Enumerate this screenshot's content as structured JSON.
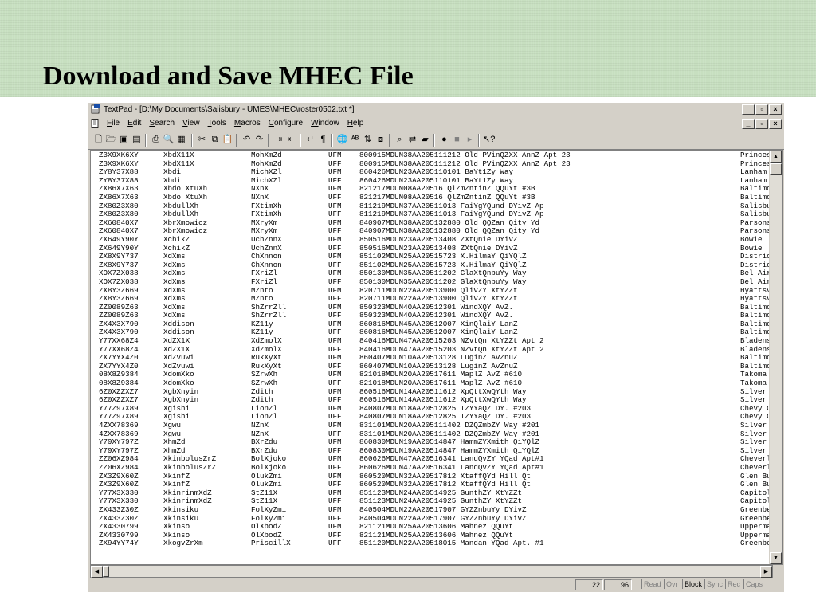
{
  "slide": {
    "title": "Download and Save MHEC File"
  },
  "window": {
    "title": "TextPad - [D:\\My Documents\\Salisbury - UMES\\MHEC\\roster0502.txt *]",
    "menus": [
      "File",
      "Edit",
      "Search",
      "View",
      "Tools",
      "Macros",
      "Configure",
      "Window",
      "Help"
    ]
  },
  "rows": [
    [
      "Z3X9XK6XY",
      "XbdX11X",
      "MohXmZd",
      "UFM",
      "800915MDUN38AA205111212 Old PVinQZXX AnnZ Apt 23",
      "Princess A"
    ],
    [
      "Z3X9XK6XY",
      "XbdX11X",
      "MohXmZd",
      "UFF",
      "800915MDUN38AA205111212 Old PVinQZXX AnnZ Apt 23",
      "Princess A"
    ],
    [
      "ZY8Y37X88",
      "Xbdi",
      "MichXZl",
      "UFM",
      "860426MDUN23AA205110101 BaYt1Zy Way",
      "Lanham"
    ],
    [
      "ZY8Y37X88",
      "Xbdi",
      "MichXZl",
      "UFF",
      "860426MDUN23AA205110101 BaYt1Zy Way",
      "Lanham"
    ],
    [
      "ZX86X7X63",
      "Xbdo XtuXh",
      "NXnX",
      "UFM",
      "821217MDUN08AA20516 QlZmZntinZ QQuYt #3B",
      "Baltimore"
    ],
    [
      "ZX86X7X63",
      "Xbdo XtuXh",
      "NXnX",
      "UFF",
      "821217MDUN08AA20516 QlZmZntinZ QQuYt #3B",
      "Baltimore"
    ],
    [
      "ZX80Z3X80",
      "XbdullXh",
      "FXtimXh",
      "UFM",
      "811219MDUN37AA20511013 FaiYgYQund DYivZ Ap",
      "Salisbury"
    ],
    [
      "ZX80Z3X80",
      "XbdullXh",
      "FXtimXh",
      "UFF",
      "811219MDUN37AA20511013 FaiYgYQund DYivZ Ap",
      "Salisbury"
    ],
    [
      "ZX60840X7",
      "XbrXmowicz",
      "MXryXm",
      "UFM",
      "840907MDUN38AA205132880 Old QQZan Qity Yd",
      "Parsonsbur"
    ],
    [
      "ZX60840X7",
      "XbrXmowicz",
      "MXryXm",
      "UFF",
      "840907MDUN38AA205132880 Old QQZan Qity Yd",
      "Parsonsbur"
    ],
    [
      "ZX649Y90Y",
      "XchikZ",
      "UchZnnX",
      "UFM",
      "850516MDUN23AA20513408 ZXtQnie DYivZ",
      "Bowie"
    ],
    [
      "ZX649Y90Y",
      "XchikZ",
      "UchZnnX",
      "UFF",
      "850516MDUN23AA20513408 ZXtQnie DYivZ",
      "Bowie"
    ],
    [
      "ZX8X9Y737",
      "XdXms",
      "ChXnnon",
      "UFM",
      "851102MDUN25AA20515723 X.HilmaY QiYQlZ",
      "District H"
    ],
    [
      "ZX8X9Y737",
      "XdXms",
      "ChXnnon",
      "UFF",
      "851102MDUN25AA20515723 X.HilmaY QiYQlZ",
      "District H"
    ],
    [
      "XOX7ZX038",
      "XdXms",
      "FXriZl",
      "UFM",
      "850130MDUN35AA20511202 GlaXtQnbuYy Way",
      "Bel Air"
    ],
    [
      "XOX7ZX038",
      "XdXms",
      "FXriZl",
      "UFF",
      "850130MDUN35AA20511202 GlaXtQnbuYy Way",
      "Bel Air"
    ],
    [
      "ZX8Y3Z669",
      "XdXms",
      "MZnto",
      "UFM",
      "820711MDUN22AA20513900 QlivZY XtYZZt",
      "Hyattsvill"
    ],
    [
      "ZX8Y3Z669",
      "XdXms",
      "MZnto",
      "UFF",
      "820711MDUN22AA20513900 QlivZY XtYZZt",
      "Hyattsvill"
    ],
    [
      "ZZ0089Z63",
      "XdXms",
      "ShZrrZll",
      "UFM",
      "850323MDUN40AA20512301 WindXQY AvZ.",
      "Baltimore"
    ],
    [
      "ZZ0089Z63",
      "XdXms",
      "ShZrrZll",
      "UFF",
      "850323MDUN40AA20512301 WindXQY AvZ.",
      "Baltimore"
    ],
    [
      "ZX4X3X790",
      "Xddison",
      "KZ11y",
      "UFM",
      "860816MDUN45AA20512007 XinQlaiY LanZ",
      "Baltimore"
    ],
    [
      "ZX4X3X790",
      "Xddison",
      "KZ11y",
      "UFF",
      "860816MDUN45AA20512007 XinQlaiY LanZ",
      "Baltimore"
    ],
    [
      "Y77XX68Z4",
      "XdZX1X",
      "XdZmolX",
      "UFM",
      "840416MDUN47AA20515203 NZvtQn XtYZZt Apt 2",
      "Bladensbur"
    ],
    [
      "Y77XX68Z4",
      "XdZX1X",
      "XdZmolX",
      "UFF",
      "840416MDUN47AA20515203 NZvtQn XtYZZt Apt 2",
      "Bladensbur"
    ],
    [
      "ZX7YYX4Z0",
      "XdZvuwi",
      "RukXyXt",
      "UFM",
      "860407MDUN10AA20513128 LuginZ AvZnuZ",
      "Baltimore"
    ],
    [
      "ZX7YYX4Z0",
      "XdZvuwi",
      "RukXyXt",
      "UFF",
      "860407MDUN10AA20513128 LuginZ AvZnuZ",
      "Baltimore"
    ],
    [
      "08X8Z9384",
      "XdomXko",
      "SZrwXh",
      "UFM",
      "821018MDUN20AA20517611 MaplZ AvZ #610",
      "Takoma Par"
    ],
    [
      "08X8Z9384",
      "XdomXko",
      "SZrwXh",
      "UFF",
      "821018MDUN20AA20517611 MaplZ AvZ #610",
      "Takoma Par"
    ],
    [
      "6Z0XZZXZ7",
      "XgbXnyin",
      "Zdith",
      "UFM",
      "860516MDUN14AA20511612 XpQttXwQYth Way",
      "Silver Spr"
    ],
    [
      "6Z0XZZXZ7",
      "XgbXnyin",
      "Zdith",
      "UFF",
      "860516MDUN14AA20511612 XpQttXwQYth Way",
      "Silver Spr"
    ],
    [
      "Y77Z97X89",
      "Xgishi",
      "LionZl",
      "UFM",
      "840807MDUN18AA20512825 TZYYaQZ DY. #203",
      "Chevy Chas"
    ],
    [
      "Y77Z97X89",
      "Xgishi",
      "LionZl",
      "UFF",
      "840807MDUN18AA20512825 TZYYaQZ DY. #203",
      "Chevy Chas"
    ],
    [
      "4ZXX78369",
      "Xgwu",
      "NZnX",
      "UFM",
      "831101MDUN20AA205111402 DZQZmbZY Way #201",
      "Silver Spr"
    ],
    [
      "4ZXX78369",
      "Xgwu",
      "NZnX",
      "UFF",
      "831101MDUN20AA205111402 DZQZmbZY Way #201",
      "Silver Spr"
    ],
    [
      "Y79XY797Z",
      "XhmZd",
      "BXrZdu",
      "UFM",
      "860830MDUN19AA20514847 HammZYXmith QiYQlZ",
      "Silver Spr"
    ],
    [
      "Y79XY797Z",
      "XhmZd",
      "BXrZdu",
      "UFF",
      "860830MDUN19AA20514847 HammZYXmith QiYQlZ",
      "Silver Spr"
    ],
    [
      "ZZ06XZ984",
      "XkinbolusZrZ",
      "BolXjoko",
      "UFM",
      "860626MDUN47AA20516341 LandQvZY YQad Apt#1",
      "Cheverly"
    ],
    [
      "ZZ06XZ984",
      "XkinbolusZrZ",
      "BolXjoko",
      "UFF",
      "860626MDUN47AA20516341 LandQvZY YQad Apt#1",
      "Cheverly"
    ],
    [
      "ZX3Z9X60Z",
      "XkinfZ",
      "OlukZmi",
      "UFM",
      "860520MDUN32AA20517812 XtaffQYd Hill Qt",
      "Glen Burni"
    ],
    [
      "ZX3Z9X60Z",
      "XkinfZ",
      "OlukZmi",
      "UFF",
      "860520MDUN32AA20517812 XtaffQYd Hill Qt",
      "Glen Burni"
    ],
    [
      "Y77X3X330",
      "XkinrinmXdZ",
      "StZ11X",
      "UFM",
      "851123MDUN24AA20514925 GunthZY XtYZZt",
      "Capitol He"
    ],
    [
      "Y77X3X330",
      "XkinrinmXdZ",
      "StZ11X",
      "UFF",
      "851123MDUN24AA20514925 GunthZY XtYZZt",
      "Capitol He"
    ],
    [
      "ZX433Z30Z",
      "Xkinsiku",
      "FolXyZmi",
      "UFM",
      "840504MDUN22AA20517907 GYZZnbuYy DYivZ",
      "Greenbelt"
    ],
    [
      "ZX433Z30Z",
      "Xkinsiku",
      "FolXyZmi",
      "UFF",
      "840504MDUN22AA20517907 GYZZnbuYy DYivZ",
      "Greenbelt"
    ],
    [
      "ZX4330799",
      "Xkinso",
      "OlXbodZ",
      "UFM",
      "821121MDUN25AA20513606 Mahnez QQuYt",
      "Uppermarlb"
    ],
    [
      "ZX4330799",
      "Xkinso",
      "OlXbodZ",
      "UFF",
      "821121MDUN25AA20513606 Mahnez QQuYt",
      "Uppermarlb"
    ],
    [
      "ZX94YY74Y",
      "XkogvZrXm",
      "PriscillX",
      "UFF",
      "851120MDUN22AA20518015 Mandan YQad Apt. #1",
      "Greenbelt"
    ]
  ],
  "status": {
    "line": "22",
    "col": "96",
    "indicators": [
      "Read",
      "Ovr",
      "Block",
      "Sync",
      "Rec",
      "Caps"
    ],
    "active": "Block"
  }
}
